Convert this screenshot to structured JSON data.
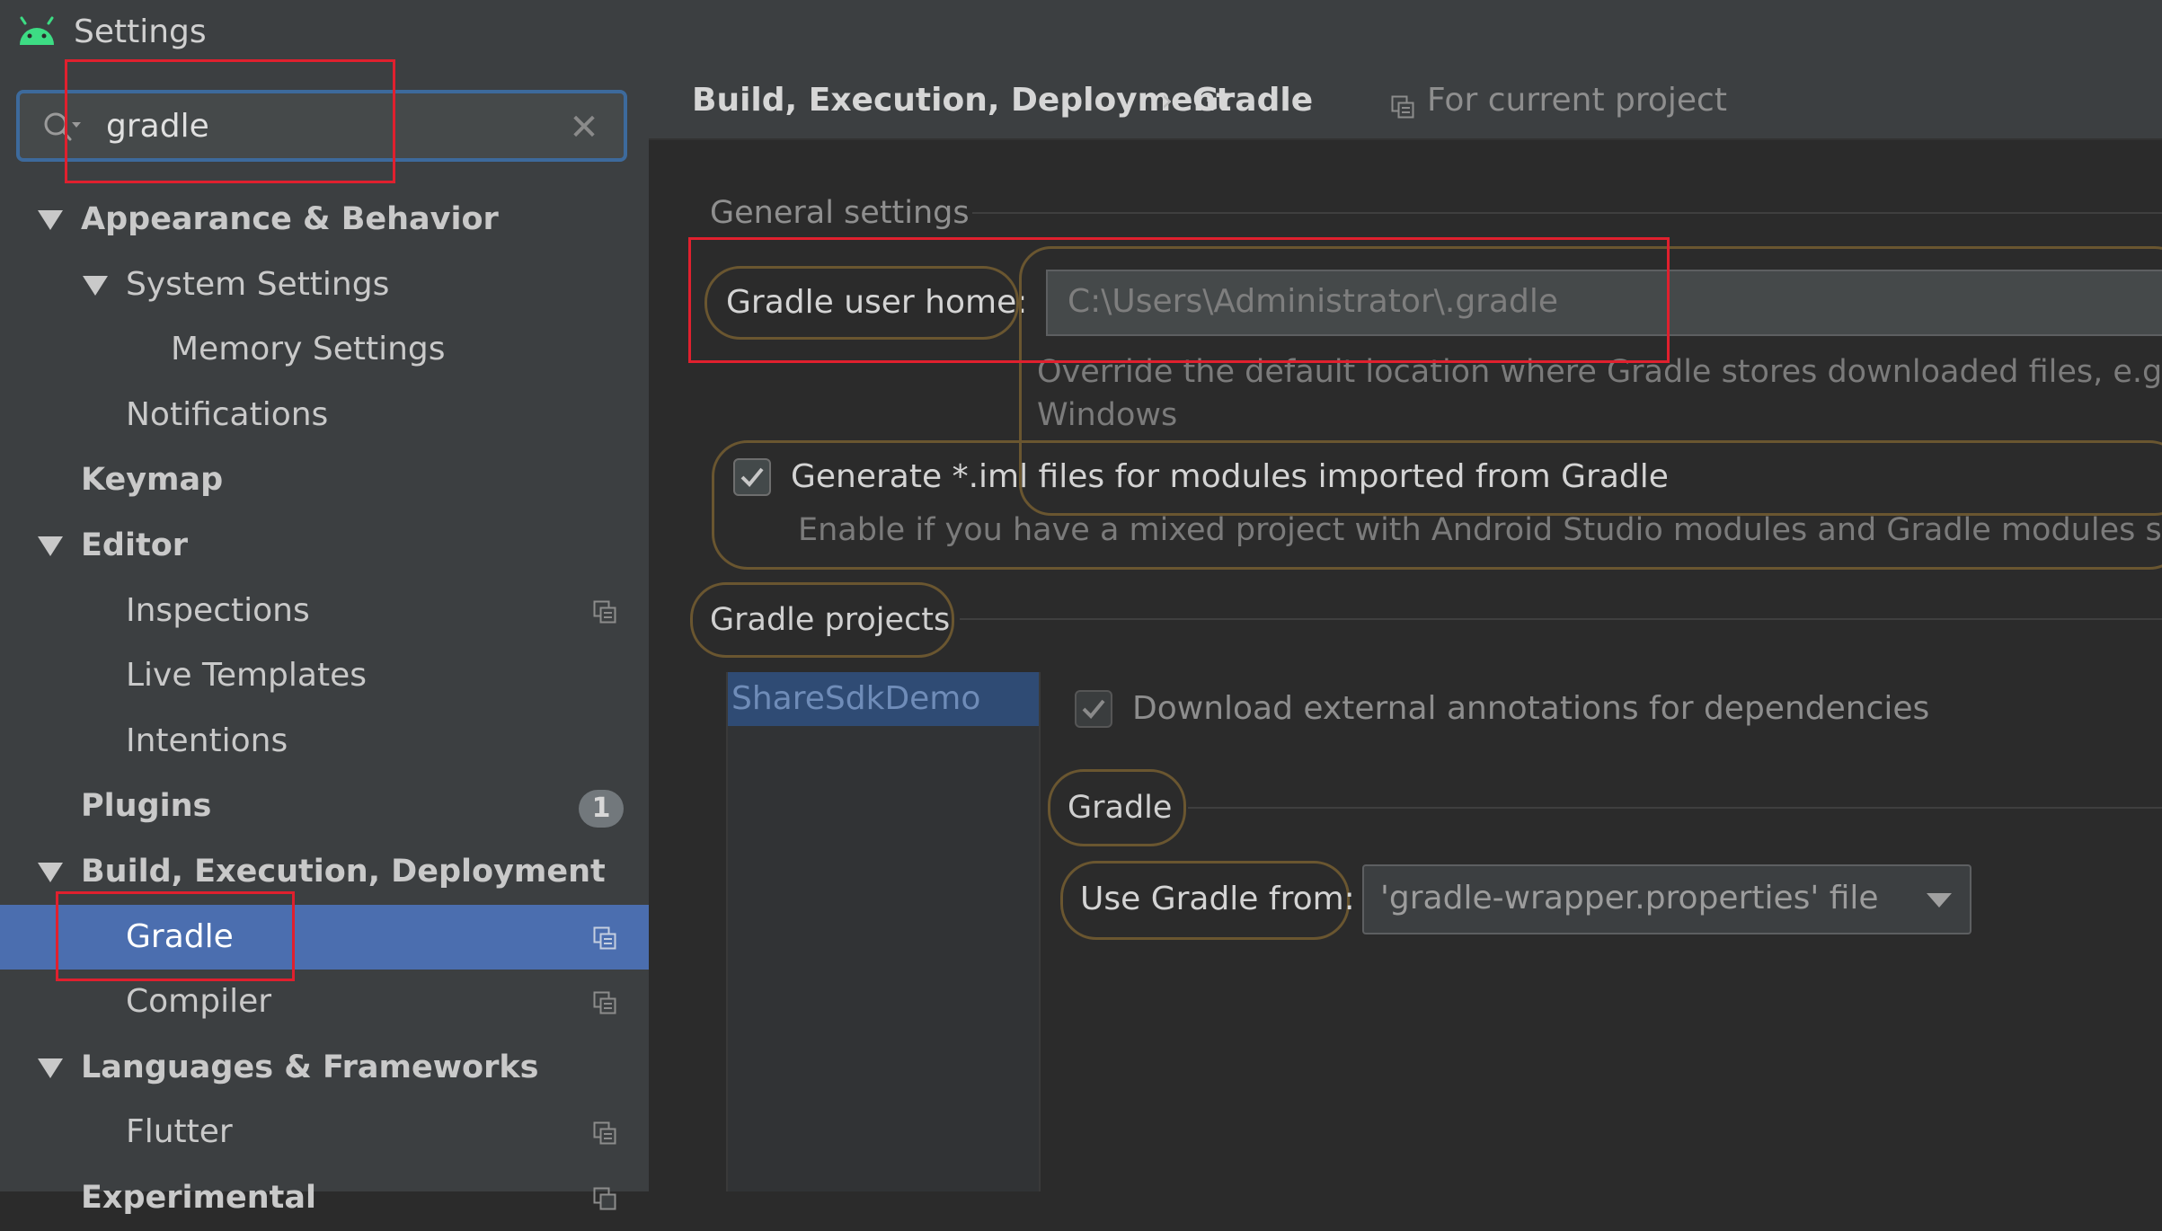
{
  "window": {
    "title": "Settings"
  },
  "search": {
    "value": "gradle"
  },
  "sidebar": {
    "items": [
      {
        "label": "Appearance & Behavior"
      },
      {
        "label": "System Settings"
      },
      {
        "label": "Memory Settings"
      },
      {
        "label": "Notifications"
      },
      {
        "label": "Keymap"
      },
      {
        "label": "Editor"
      },
      {
        "label": "Inspections"
      },
      {
        "label": "Live Templates"
      },
      {
        "label": "Intentions"
      },
      {
        "label": "Plugins",
        "badge": "1"
      },
      {
        "label": "Build, Execution, Deployment"
      },
      {
        "label": "Gradle"
      },
      {
        "label": "Compiler"
      },
      {
        "label": "Languages & Frameworks"
      },
      {
        "label": "Flutter"
      },
      {
        "label": "Experimental"
      }
    ]
  },
  "breadcrumb": {
    "parent": "Build, Execution, Deployment",
    "separator": "›",
    "current": "Gradle",
    "scope": "For current project"
  },
  "general": {
    "title": "General settings",
    "user_home_label": "Gradle user home:",
    "user_home_placeholder": "C:\\Users\\Administrator\\.gradle",
    "user_home_hint_line1": "Override the default location where Gradle stores downloaded files, e.g. to tu",
    "user_home_hint_line2": "Windows",
    "iml_label": "Generate *.iml files for modules imported from Gradle",
    "iml_checked": true,
    "iml_hint": "Enable if you have a mixed project with Android Studio modules and Gradle modules so that"
  },
  "projects": {
    "title": "Gradle projects",
    "items": [
      "ShareSdkDemo"
    ],
    "download_annotations_label": "Download external annotations for dependencies",
    "download_annotations_checked": true,
    "gradle_group_title": "Gradle",
    "use_gradle_from_label": "Use Gradle from:",
    "use_gradle_from_value": "'gradle-wrapper.properties' file"
  },
  "colors": {
    "selection": "#4b6eaf",
    "accent_outline": "#6a5630",
    "highlight_box": "#e0202e",
    "android_green": "#3ddc84"
  }
}
